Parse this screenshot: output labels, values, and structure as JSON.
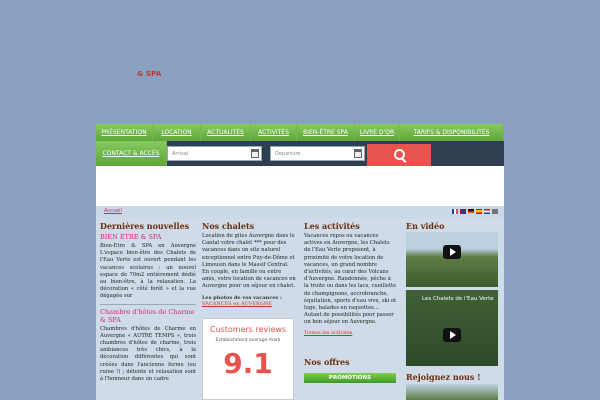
{
  "logo": {
    "spa_text": "& SPA"
  },
  "nav": {
    "row1": [
      "Présentation",
      "Location",
      "Actualités",
      "Activités",
      "Bien-être Spa",
      "Livre d'Or",
      "Tarifs & Disponibilités"
    ],
    "row2": [
      "Contact & accès"
    ]
  },
  "search": {
    "arrival_placeholder": "Arrival",
    "departure_placeholder": "Departure"
  },
  "breadcrumb": {
    "home": "Accueil"
  },
  "col1": {
    "heading": "Dernières nouvelles",
    "item1_title": "BIEN ETRE & SPA",
    "item1_text": "Bien-Etre & SPA en Auvergne L'espace bien-être des Chalets de l'Eau Verte est ouvert pendant les vacances scolaires : un nouvel espace de 70m2 entièrement dédié au bien-être, à la relaxation. La décoration « côté forêt » et la vue dégagée sur",
    "item2_title": "Chambre d'hôtes de Charme & SPA",
    "item2_text": "Chambres d'hôtes de Charme en Auvergne « AUTRE TEMPS », trois chambres d'hôtes de charme, trois ambiances très chics, à la décoration différentes qui sont créées dans l'ancienne ferme (ou ruine !) ; détente et relaxation sont à l'honneur dans un cadre"
  },
  "col2": {
    "heading": "Nos chalets",
    "text": "Location de gites Auvergne dans le Cantal votre chalet *** pour des vacances dans un site naturel exceptionnel entre Puy-de-Dôme et Limousin dans le Massif Central. En couple, en famille ou entre amis, votre location de vacances en Auvergne pour un séjour en chalet.",
    "photos_title": "Les photos de vos vacances :",
    "photos_link": "VACANCES en AUVERGNE",
    "reviews_title": "Customers reviews",
    "reviews_label": "Establishment average mark",
    "reviews_score": "9.1"
  },
  "col3": {
    "heading": "Les activités",
    "text": "Vacances repos ou vacances actives en Auvergne, les Chalets de l'Eau Verte proposent, à proximité de votre location de vacances, un grand nombre d'activités, au cœur des Volcans d'Auvergne. Randonnée, pêche à la truite ou dans les lacs, cueillette de champignons, accrobranche, équitation, sports d'eau vive, ski et luge, balades en raquettes... Autant de possibilités pour passer un bon séjour en Auvergne.",
    "all_link": "Toutes les activités",
    "offers_heading": "Nos offres",
    "promo_button": "PROMOTIONS"
  },
  "col4": {
    "heading": "En vidéo",
    "video2_caption": "Les Chalets de l'Eau Verte",
    "join_heading": "Rejoignez nous !"
  },
  "colors": {
    "accent": "#e9534d",
    "nav_green": "#6ab84a",
    "heading_brown": "#6b2d0a",
    "pink": "#d0267a"
  }
}
